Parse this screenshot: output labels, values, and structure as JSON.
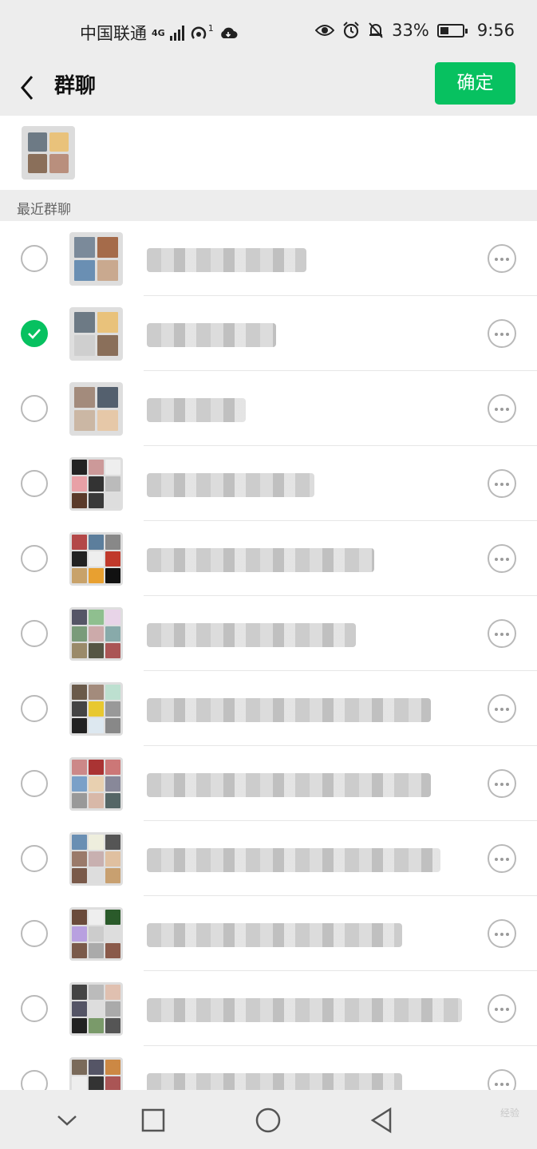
{
  "status_bar": {
    "carrier": "中国联通",
    "network": "4G",
    "hotspot_count": "1",
    "battery": "33%",
    "time": "9:56"
  },
  "header": {
    "title": "群聊",
    "confirm_label": "确定"
  },
  "section": {
    "label": "最近群聊"
  },
  "groups": [
    {
      "checked": false,
      "name_width": 200
    },
    {
      "checked": true,
      "name_width": 162
    },
    {
      "checked": false,
      "name_width": 124
    },
    {
      "checked": false,
      "name_width": 210
    },
    {
      "checked": false,
      "name_width": 285
    },
    {
      "checked": false,
      "name_width": 262
    },
    {
      "checked": false,
      "name_width": 356
    },
    {
      "checked": false,
      "name_width": 356
    },
    {
      "checked": false,
      "name_width": 368
    },
    {
      "checked": false,
      "name_width": 320
    },
    {
      "checked": false,
      "name_width": 395
    },
    {
      "checked": false,
      "name_width": 320
    }
  ],
  "nav": {
    "icons": [
      "chevron-down-icon",
      "square-icon",
      "circle-icon",
      "back-triangle-icon"
    ]
  },
  "watermark": "经验"
}
